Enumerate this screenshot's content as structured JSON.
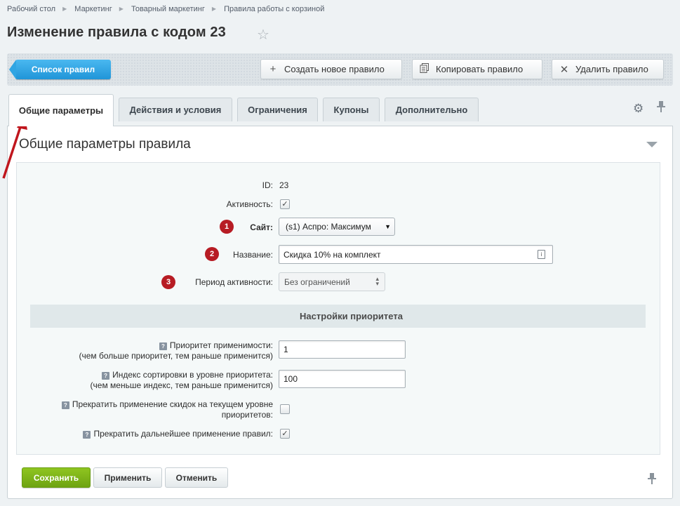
{
  "breadcrumb": [
    "Рабочий стол",
    "Маркетинг",
    "Товарный маркетинг",
    "Правила работы с корзиной"
  ],
  "page_title": "Изменение правила с кодом 23",
  "toolbar": {
    "list_button": "Список правил",
    "create_button": "Создать новое правило",
    "copy_button": "Копировать правило",
    "delete_button": "Удалить правило"
  },
  "tabs": [
    "Общие параметры",
    "Действия и условия",
    "Ограничения",
    "Купоны",
    "Дополнительно"
  ],
  "section_title": "Общие параметры правила",
  "fields": {
    "id_label": "ID:",
    "id_value": "23",
    "active_label": "Активность:",
    "active_checked": true,
    "site_label": "Сайт:",
    "site_value": "(s1) Аспро: Максимум",
    "name_label": "Название:",
    "name_value": "Скидка 10% на комплект",
    "period_label": "Период активности:",
    "period_value": "Без ограничений"
  },
  "badges": [
    "1",
    "2",
    "3"
  ],
  "priority": {
    "header": "Настройки приоритета",
    "applicability_label": "Приоритет применимости:",
    "applicability_hint": "(чем больше приоритет, тем раньше применится)",
    "applicability_value": "1",
    "sort_label": "Индекс сортировки в уровне приоритета:",
    "sort_hint": "(чем меньше индекс, тем раньше применится)",
    "sort_value": "100",
    "stop_level_label_1": "Прекратить применение скидок на текущем уровне",
    "stop_level_label_2": "приоритетов:",
    "stop_level_checked": false,
    "stop_further_label": "Прекратить дальнейшее применение правил:",
    "stop_further_checked": true
  },
  "buttons": {
    "save": "Сохранить",
    "apply": "Применить",
    "cancel": "Отменить"
  },
  "colors": {
    "accent_blue": "#2095d8",
    "save_green": "#7ab317",
    "badge_red": "#b71c24",
    "annotation_red": "#c0161d"
  }
}
